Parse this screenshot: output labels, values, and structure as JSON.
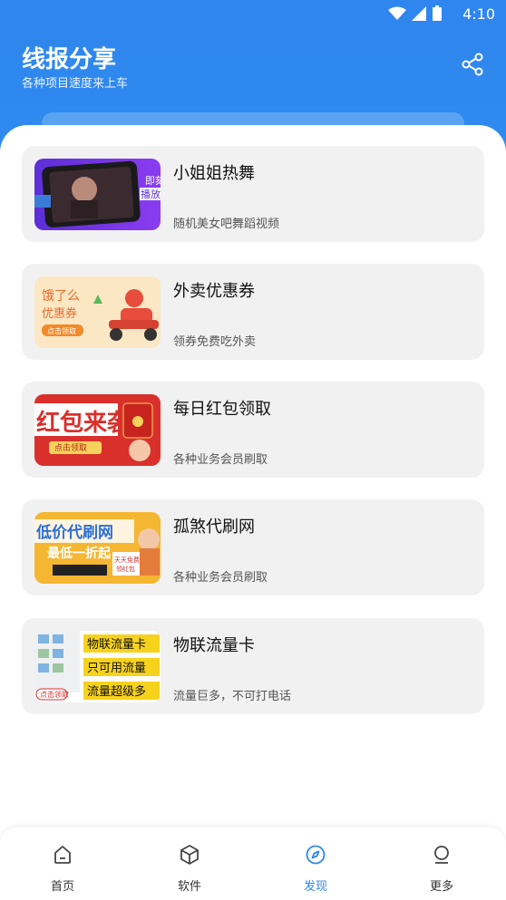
{
  "status_bar": {
    "time": "4:10"
  },
  "header": {
    "title": "线报分享",
    "subtitle": "各种项目速度来上车",
    "share_icon": "share-icon",
    "accent": "#2f86ee"
  },
  "cards": [
    {
      "title": "小姐姐热舞",
      "desc": "随机美女吧舞蹈视频",
      "thumb_text": [
        "即刻",
        "播放"
      ]
    },
    {
      "title": "外卖优惠券",
      "desc": "领券免费吃外卖",
      "thumb_text": [
        "饿了么",
        "优惠券",
        "点击领取"
      ]
    },
    {
      "title": "每日红包领取",
      "desc": "各种业务会员刷取",
      "thumb_text": [
        "红包来袭!",
        "点击领取"
      ]
    },
    {
      "title": "孤煞代刷网",
      "desc": "各种业务会员刷取",
      "thumb_text": [
        "低价代刷网",
        "最低一折起",
        "天天免费",
        "领红包"
      ]
    },
    {
      "title": "物联流量卡",
      "desc": "流量巨多，不可打电话",
      "thumb_text": [
        "物联流量卡",
        "只可用流量",
        "流量超级多",
        "点击领取"
      ]
    }
  ],
  "tabs": [
    {
      "label": "首页",
      "icon": "home-icon",
      "active": false
    },
    {
      "label": "软件",
      "icon": "cube-icon",
      "active": false
    },
    {
      "label": "发现",
      "icon": "compass-icon",
      "active": true
    },
    {
      "label": "更多",
      "icon": "user-icon",
      "active": false
    }
  ]
}
